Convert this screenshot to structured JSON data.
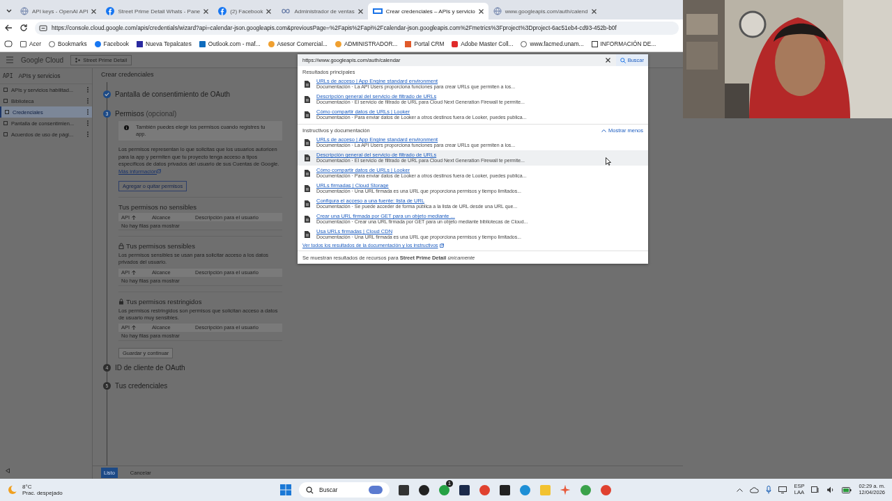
{
  "browser": {
    "tabs": [
      {
        "title": "API keys - OpenAI API",
        "selected": false
      },
      {
        "title": "Street Prime Detail Whats - Pane",
        "selected": false
      },
      {
        "title": "(2) Facebook",
        "selected": false
      },
      {
        "title": "Administrador de ventas",
        "selected": false
      },
      {
        "title": "Crear credenciales – APIs y servicio",
        "selected": true
      },
      {
        "title": "www.googleapis.com/auth/calend",
        "selected": false
      }
    ],
    "url": "https://console.cloud.google.com/apis/credentials/wizard?api=calendar-json.googleapis.com&previousPage=%2Fapis%2Fapi%2Fcalendar-json.googleapis.com%2Fmetrics%3Fproject%3Dproject-6ac51eb4-cd93-452b-b0f",
    "bookmarks": [
      "Acer",
      "Bookmarks",
      "Facebook",
      "Nueva Tepalcates",
      "Outlook.com - maf...",
      "Asesor Comercial...",
      "ADMINISTRADOR...",
      "Portal CRM",
      "Adobe Master Coll...",
      "www.facmed.unam...",
      "INFORMACIÓN DE..."
    ]
  },
  "console": {
    "product": "Google Cloud",
    "project": "Street Prime Detail",
    "sidebar": {
      "badge": "API",
      "title": "APIs y servicios",
      "items": [
        {
          "label": "APIs y servicios habilitad...",
          "selected": false
        },
        {
          "label": "Biblioteca",
          "selected": false
        },
        {
          "label": "Credenciales",
          "selected": true
        },
        {
          "label": "Pantalla de consentimien...",
          "selected": false
        },
        {
          "label": "Acuerdos de uso de pági...",
          "selected": false
        }
      ]
    },
    "title": "Crear credenciales",
    "step_done": "Pantalla de consentimiento de OAuth",
    "step_current": {
      "number": "3",
      "title": "Permisos",
      "hint": "(opcional)"
    },
    "info": "También puedes elegir los permisos cuando registres tu app.",
    "description": "Los permisos representan lo que solicitas que los usuarios autoricen para la app y permiten que tu proyecto tenga acceso a tipos específicos de datos privados del usuario de sus Cuentas de Google.",
    "more_link": "Más información",
    "add_button": "Agregar o quitar permisos",
    "scope_sections": [
      {
        "title": "Tus permisos no sensibles",
        "kind": "plain",
        "columns": [
          "API",
          "Alcance",
          "Descripción para el usuario"
        ],
        "empty": "No hay filas para mostrar"
      },
      {
        "title": "Tus permisos sensibles",
        "kind": "sensitive",
        "description": "Los permisos sensibles se usan para solicitar acceso a los datos privados del usuario.",
        "columns": [
          "API",
          "Alcance",
          "Descripción para el usuario"
        ],
        "empty": "No hay filas para mostrar"
      },
      {
        "title": "Tus permisos restringidos",
        "kind": "restricted",
        "description": "Los permisos restringidos son permisos que solicitan acceso a datos de usuario muy sensibles.",
        "columns": [
          "API",
          "Alcance",
          "Descripción para el usuario"
        ],
        "empty": "No hay filas para mostrar"
      }
    ],
    "save_button": "Guardar y continuar",
    "next_steps": [
      {
        "number": "4",
        "title": "ID de cliente de OAuth"
      },
      {
        "number": "5",
        "title": "Tus credenciales"
      }
    ],
    "done_button": "Listo",
    "cancel_button": "Cancelar"
  },
  "search_popup": {
    "query": "https://www.googleapis.com/auth/calendar",
    "search_button": "Buscar",
    "sections": [
      {
        "title": "Resultados principales",
        "results": [
          {
            "title": "URLs de acceso | App Engine standard environment",
            "snippet": "Documentación · La API Users proporciona funciones para crear URLs que permiten a los...",
            "highlighted": false
          },
          {
            "title": "Descripción general del servicio de filtrado de URLs",
            "snippet": "Documentación · El servicio de filtrado de URL para Cloud Next Generation Firewall te permite...",
            "highlighted": false
          },
          {
            "title": "Cómo compartir datos de URLs | Looker",
            "snippet": "Documentación · Para enviar datos de Looker a otros destinos fuera de Looker, puedes publica...",
            "highlighted": false
          }
        ]
      },
      {
        "title": "Instructivos y documentación",
        "toggle": "Mostrar menos",
        "results": [
          {
            "title": "URLs de acceso | App Engine standard environment",
            "snippet": "Documentación · La API Users proporciona funciones para crear URLs que permiten a los...",
            "highlighted": false
          },
          {
            "title": "Descripción general del servicio de filtrado de URLs",
            "snippet": "Documentación · El servicio de filtrado de URL para Cloud Next Generation Firewall te permite...",
            "highlighted": true
          },
          {
            "title": "Cómo compartir datos de URLs | Looker",
            "snippet": "Documentación · Para enviar datos de Looker a otros destinos fuera de Looker, puedes publica...",
            "highlighted": false
          },
          {
            "title": "URLs firmadas | Cloud Storage",
            "snippet": "Documentación · Una URL firmada es una URL que proporciona permisos y tiempo limitados...",
            "highlighted": false
          },
          {
            "title": "Configura el acceso a una fuente: lista de URL",
            "snippet": "Documentación · Se puede acceder de forma pública a la lista de URL desde una URL que...",
            "highlighted": false
          },
          {
            "title": "Crear una URL firmada por GET para un objeto mediante ...",
            "snippet": "Documentación · Crear una URL firmada por GET para un objeto mediante bibliotecas de Cloud...",
            "highlighted": false
          },
          {
            "title": "Usa URLs firmadas | Cloud CDN",
            "snippet": "Documentación · Una URL firmada es una URL que proporciona permisos y tiempo limitados...",
            "highlighted": false
          }
        ],
        "all_link": "Ver todos los resultados de la documentación y los instructivos"
      }
    ],
    "footer": "Se muestran resultados de recursos para **Street Prime Detail** *únicamente*"
  },
  "taskbar": {
    "temperature": "8°C",
    "weather": "Prac. despejado",
    "search_placeholder": "Buscar",
    "whatsapp_badge": "1",
    "language": "ESP",
    "layout": "LAA",
    "time": "02:29 a. m.",
    "date": "12/04/2026"
  }
}
